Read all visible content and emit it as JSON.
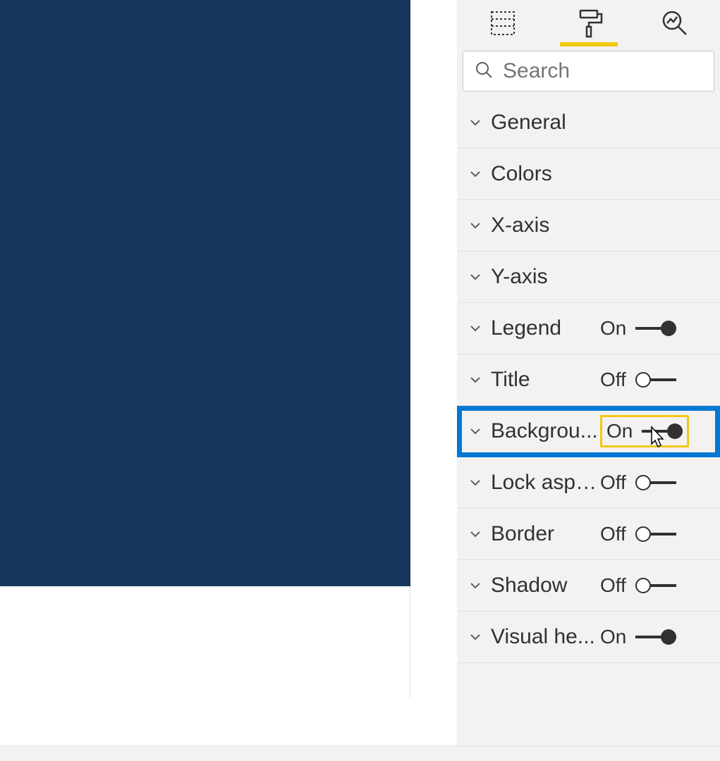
{
  "search": {
    "placeholder": "Search"
  },
  "toggle_labels": {
    "on": "On",
    "off": "Off"
  },
  "sections": {
    "general": "General",
    "colors": "Colors",
    "xaxis": "X-axis",
    "yaxis": "Y-axis",
    "legend": "Legend",
    "title": "Title",
    "background": "Backgrou...",
    "lockaspect": "Lock aspe...",
    "border": "Border",
    "shadow": "Shadow",
    "visualheader": "Visual he..."
  }
}
